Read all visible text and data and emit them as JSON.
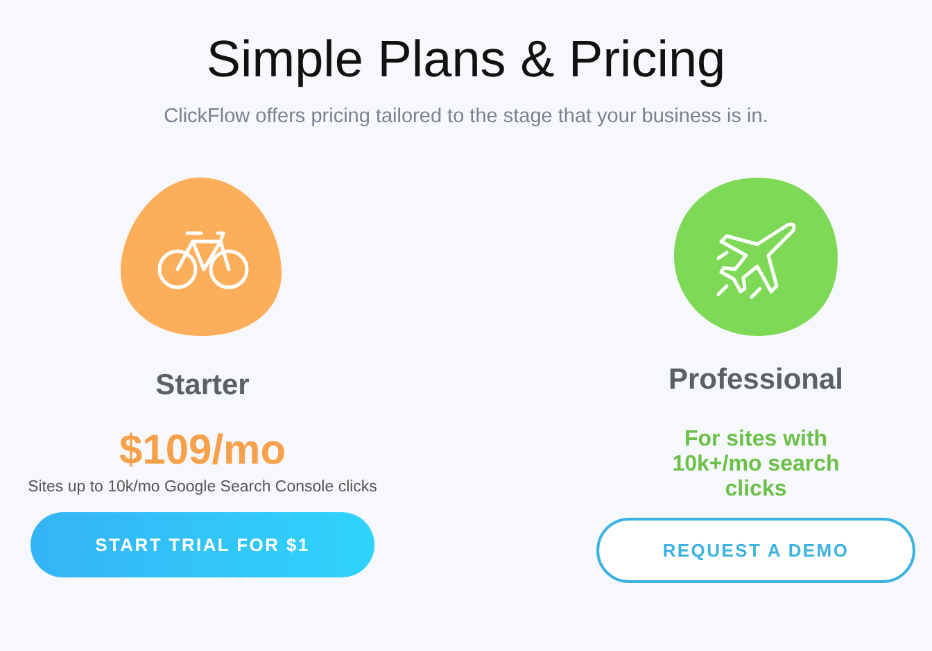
{
  "header": {
    "title": "Simple Plans & Pricing",
    "subtitle": "ClickFlow offers pricing tailored to the stage that your business is in."
  },
  "plans": [
    {
      "name": "Starter",
      "color": "#fdae5a",
      "price": "$109/mo",
      "description": "Sites up to 10k/mo Google Search Console clicks",
      "button": {
        "label": "START TRIAL FOR $1",
        "kind": "filled"
      }
    },
    {
      "name": "Professional",
      "color": "#7ed957",
      "note": "For sites with 10k+/mo search clicks",
      "button": {
        "label": "REQUEST A DEMO",
        "kind": "outline"
      }
    }
  ]
}
